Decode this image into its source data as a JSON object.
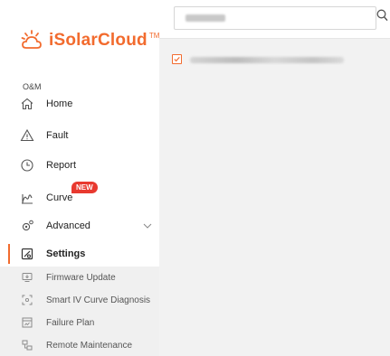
{
  "brand": {
    "name": "iSolarCloud",
    "tm": "TM",
    "accent": "#f26b2e"
  },
  "sidebar": {
    "section": "O&M",
    "items": [
      {
        "label": "Home",
        "icon": "home-icon"
      },
      {
        "label": "Fault",
        "icon": "warning-icon"
      },
      {
        "label": "Report",
        "icon": "report-clock-icon"
      },
      {
        "label": "Curve",
        "icon": "curve-icon",
        "badge": "NEW"
      },
      {
        "label": "Advanced",
        "icon": "advanced-gear-icon"
      },
      {
        "label": "Settings",
        "icon": "settings-icon",
        "active": true
      }
    ],
    "subitems": [
      {
        "label": "Firmware Update",
        "icon": "firmware-icon"
      },
      {
        "label": "Smart IV Curve Diagnosis",
        "icon": "diagnosis-icon"
      },
      {
        "label": "Failure Plan",
        "icon": "failure-plan-icon"
      },
      {
        "label": "Remote Maintenance",
        "icon": "remote-maintenance-icon"
      }
    ]
  },
  "search": {
    "icon": "search-icon"
  },
  "list": {
    "checkbox_checked": true
  }
}
